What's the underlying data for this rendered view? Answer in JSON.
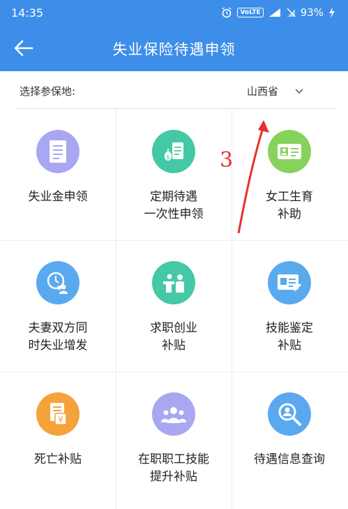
{
  "status_bar": {
    "time": "14:35",
    "network_badge": "VoLTE",
    "battery": "93%"
  },
  "header": {
    "title": "失业保险待遇申领",
    "back_icon": "arrow-left-icon"
  },
  "region": {
    "label": "选择参保地:",
    "value": "山西省"
  },
  "services": [
    {
      "label": "失业金申领",
      "icon": "document-list-icon",
      "color": "#a9a6f2"
    },
    {
      "label": "定期待遇\n一次性申领",
      "icon": "money-bag-icon",
      "color": "#45c8a6"
    },
    {
      "label": "女工生育\n补助",
      "icon": "id-card-icon",
      "color": "#86d25b"
    },
    {
      "label": "夫妻双方同\n时失业增发",
      "icon": "clock-people-icon",
      "color": "#5aa9ef"
    },
    {
      "label": "求职创业\n补贴",
      "icon": "podium-icon",
      "color": "#45c8a6"
    },
    {
      "label": "技能鉴定\n补贴",
      "icon": "certificate-icon",
      "color": "#5aa9ef"
    },
    {
      "label": "死亡补贴",
      "icon": "yen-document-icon",
      "color": "#f5a23a"
    },
    {
      "label": "在职职工技能\n提升补贴",
      "icon": "group-icon",
      "color": "#a9a6f2"
    },
    {
      "label": "待遇信息查询",
      "icon": "search-person-icon",
      "color": "#5aa9ef"
    }
  ],
  "annotation": {
    "number": "3",
    "color": "#e8312a"
  }
}
